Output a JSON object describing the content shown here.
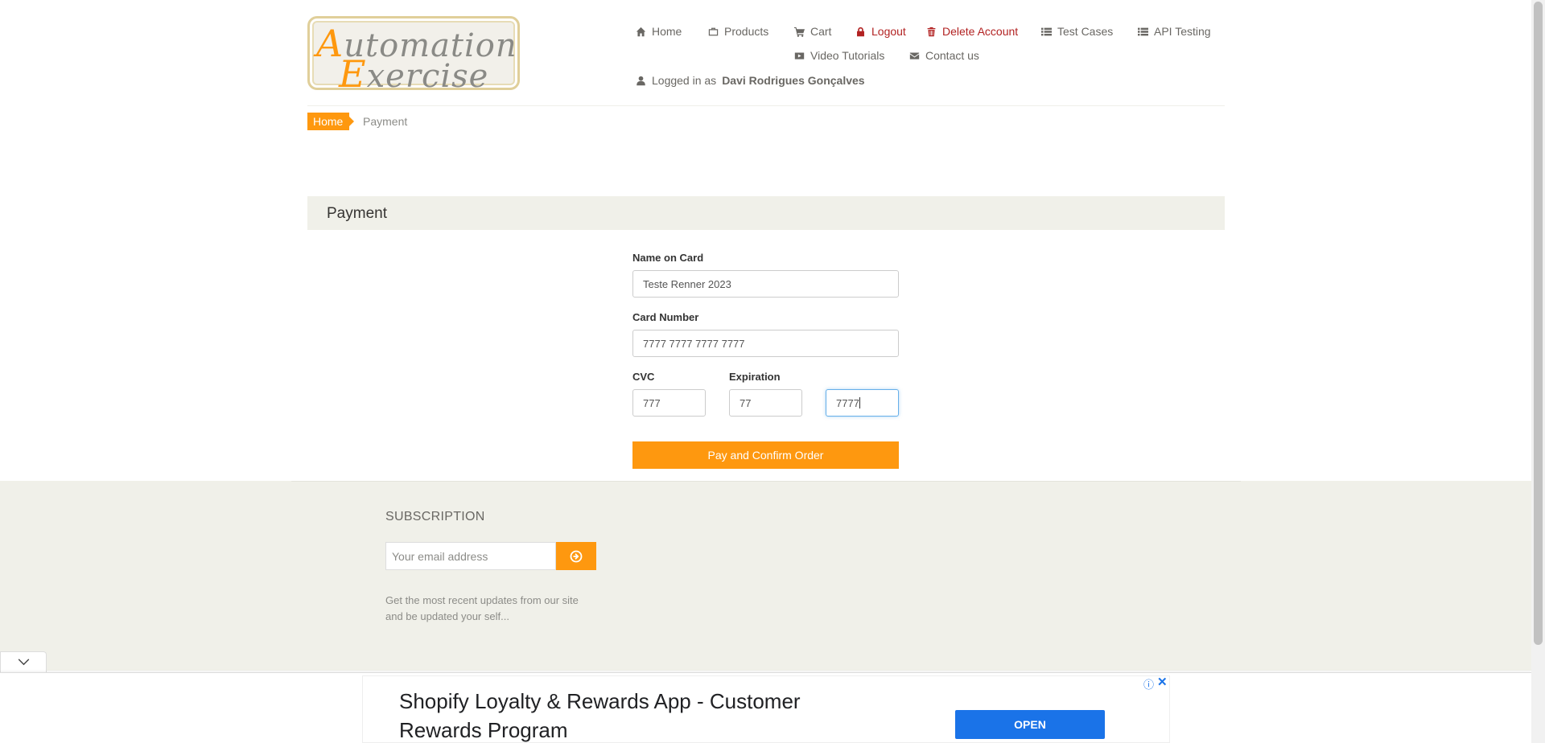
{
  "logo": {
    "line1_cap": "A",
    "line1_rest": "utomation",
    "line2_cap": "E",
    "line2_rest": "xercise"
  },
  "nav": {
    "home": "Home",
    "products": "Products",
    "cart": "Cart",
    "logout": "Logout",
    "delete_account": "Delete Account",
    "test_cases": "Test Cases",
    "api_testing": "API Testing",
    "video_tutorials": "Video Tutorials",
    "contact_us": "Contact us",
    "logged_in_prefix": "Logged in as",
    "logged_in_user": "Davi Rodrigues Gonçalves"
  },
  "breadcrumb": {
    "home": "Home",
    "current": "Payment"
  },
  "payment": {
    "heading": "Payment",
    "name_on_card_label": "Name on Card",
    "name_on_card_value": "Teste Renner 2023",
    "card_number_label": "Card Number",
    "card_number_value": "7777 7777 7777 7777",
    "cvc_label": "CVC",
    "cvc_value": "777",
    "expiration_label": "Expiration",
    "expiry_month_value": "77",
    "expiry_year_value": "7777",
    "submit_label": "Pay and Confirm Order"
  },
  "footer": {
    "subscription_title": "SUBSCRIPTION",
    "email_placeholder": "Your email address",
    "description": "Get the most recent updates from our site and be updated your self..."
  },
  "ad": {
    "title": "Shopify Loyalty & Rewards App - Customer Rewards Program",
    "open_label": "OPEN",
    "info_glyph": "ⓘ",
    "close_glyph": "✕"
  },
  "colors": {
    "accent": "#fe980f",
    "danger": "#b22222",
    "panel": "#f0f0e9",
    "ad_button": "#1a73e8"
  }
}
